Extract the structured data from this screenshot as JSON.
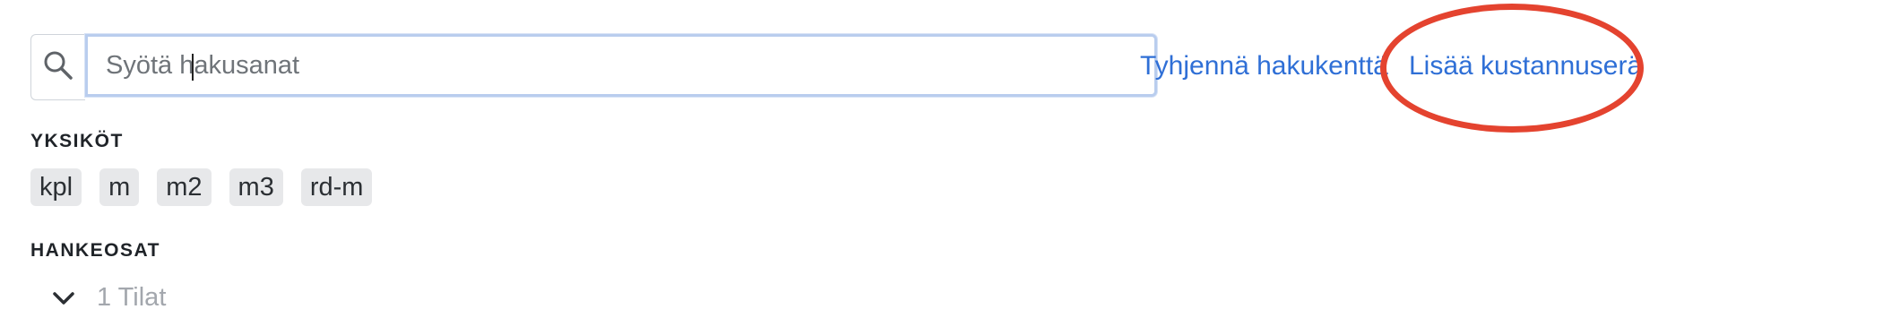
{
  "search": {
    "icon": "search-icon",
    "placeholder": "Syötä hakusanat",
    "value": ""
  },
  "actions": {
    "clear_label": "Tyhjennä hakukenttä",
    "add_label": "Lisää kustannuserä",
    "link_color": "#2f6fd6",
    "highlight_color": "#e4432f"
  },
  "units": {
    "heading": "YKSIKÖT",
    "chips": [
      {
        "label": "kpl"
      },
      {
        "label": "m"
      },
      {
        "label": "m2"
      },
      {
        "label": "m3"
      },
      {
        "label": "rd-m"
      }
    ]
  },
  "project_parts": {
    "heading": "HANKEOSAT",
    "items": [
      {
        "label": "1 Tilat",
        "icon": "chevron-down-icon",
        "expanded": true
      }
    ]
  }
}
